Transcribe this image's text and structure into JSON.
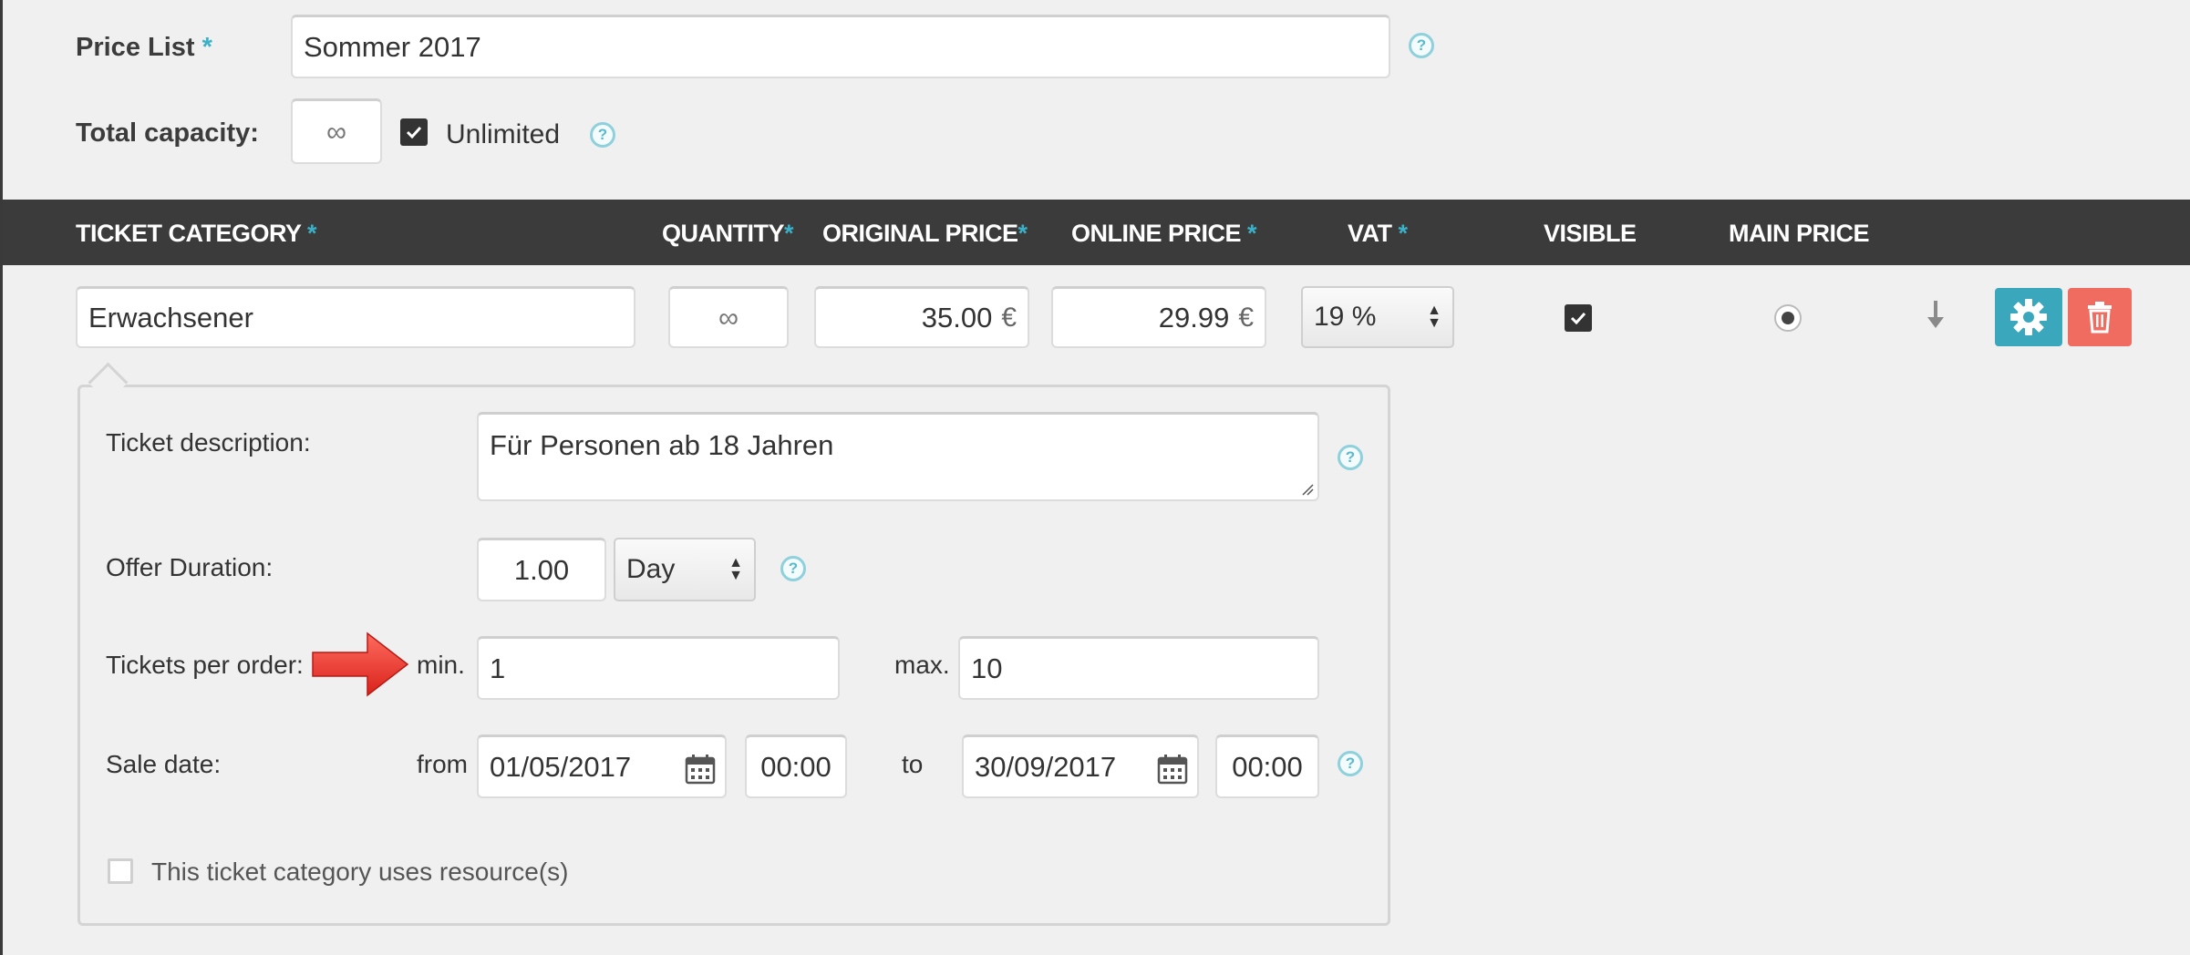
{
  "price_list": {
    "label": "Price List",
    "required": "*",
    "value": "Sommer 2017",
    "help": "?"
  },
  "capacity": {
    "label": "Total capacity:",
    "value": "∞",
    "unlimited_label": "Unlimited",
    "unlimited_checked": true,
    "help": "?"
  },
  "table_header": {
    "ticket_category": "TICKET CATEGORY",
    "quantity": "QUANTITY",
    "original_price": "ORIGINAL PRICE",
    "online_price": "ONLINE PRICE",
    "vat": "VAT",
    "visible": "VISIBLE",
    "main_price": "MAIN PRICE",
    "required": "*"
  },
  "ticket_row": {
    "category": "Erwachsener",
    "quantity": "∞",
    "original_price": "35.00",
    "online_price": "29.99",
    "currency": "€",
    "vat": "19 %",
    "visible_checked": true,
    "main_price_selected": true
  },
  "details": {
    "description_label": "Ticket description:",
    "description_value": "Für Personen ab 18 Jahren",
    "description_help": "?",
    "duration_label": "Offer Duration:",
    "duration_value": "1.00",
    "duration_unit": "Day",
    "duration_help": "?",
    "tickets_label": "Tickets per order:",
    "min_label": "min.",
    "min_value": "1",
    "max_label": "max.",
    "max_value": "10",
    "sale_label": "Sale date:",
    "from_label": "from",
    "from_date": "01/05/2017",
    "from_time": "00:00",
    "to_label": "to",
    "to_date": "30/09/2017",
    "to_time": "00:00",
    "sale_help": "?",
    "resources_label": "This ticket category uses resource(s)",
    "resources_checked": false
  },
  "colors": {
    "accent": "#3ab1c8",
    "header_bg": "#3b3b3b",
    "gear_button": "#3aa7bd",
    "trash_button": "#f06c61",
    "arrow": "#e8302a"
  },
  "icons": {
    "help": "question-circle-icon",
    "calendar": "calendar-icon",
    "gear": "gear-icon",
    "trash": "trash-icon",
    "move": "arrow-down-icon",
    "pointer": "red-arrow-icon"
  }
}
